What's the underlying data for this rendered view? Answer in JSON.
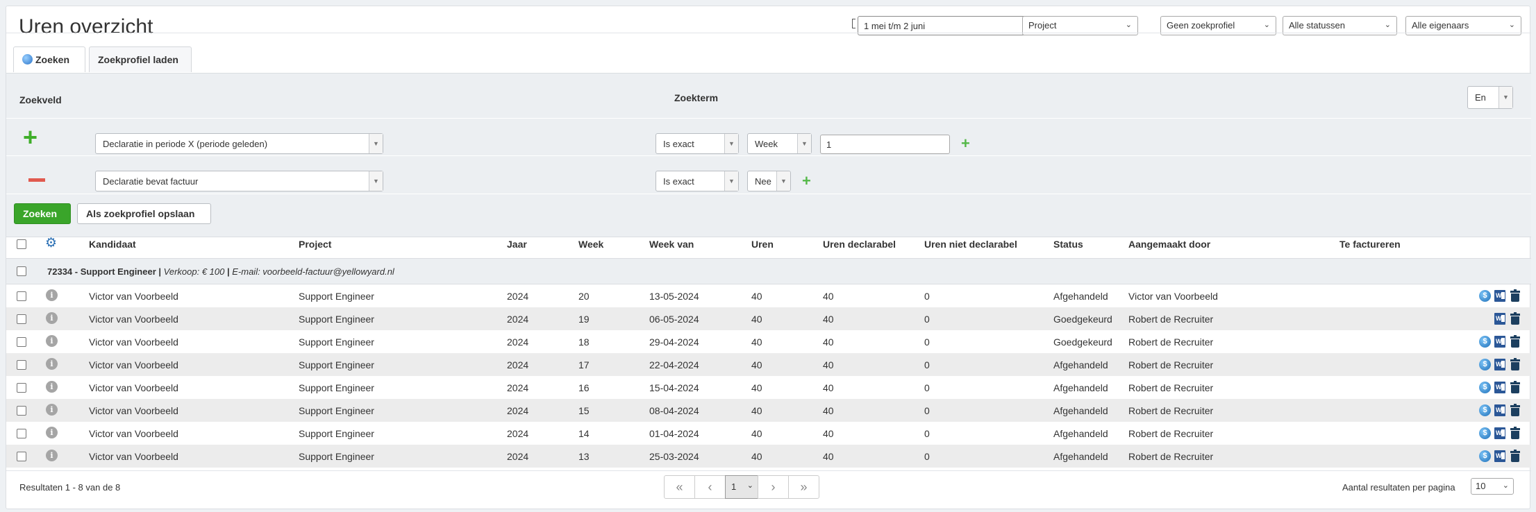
{
  "header": {
    "title": "Uren overzicht",
    "date_range": "1 mei t/m 2 juni",
    "filters": [
      "Project",
      "Geen zoekprofiel",
      "Alle statussen",
      "Alle eigenaars"
    ]
  },
  "tabs": {
    "search": "Zoeken",
    "load_profile": "Zoekprofiel laden"
  },
  "search": {
    "field_label": "Zoekveld",
    "term_label": "Zoekterm",
    "conjunction": "En",
    "conditions": [
      {
        "field": "Declaratie in periode X (periode geleden)",
        "operator": "Is exact",
        "unit": "Week",
        "value": "1"
      },
      {
        "field": "Declaratie bevat factuur",
        "operator": "Is exact",
        "unit": "Nee"
      }
    ],
    "search_button": "Zoeken",
    "save_button": "Als zoekprofiel opslaan"
  },
  "table": {
    "columns": [
      "Kandidaat",
      "Project",
      "Jaar",
      "Week",
      "Week van",
      "Uren",
      "Uren declarabel",
      "Uren niet declarabel",
      "Status",
      "Aangemaakt door",
      "Te factureren"
    ],
    "group": {
      "title": "72334 - Support Engineer",
      "sep1": "|",
      "sale": "Verkoop: € 100",
      "sep2": "|",
      "email": "E-mail: voorbeeld-factuur@yellowyard.nl"
    },
    "rows": [
      {
        "kandidaat": "Victor van Voorbeeld",
        "project": "Support Engineer",
        "jaar": "2024",
        "week": "20",
        "week_van": "13-05-2024",
        "uren": "40",
        "declarabel": "40",
        "niet_declarabel": "0",
        "status": "Afgehandeld",
        "door": "Victor van Voorbeeld",
        "invoice_icon": true
      },
      {
        "kandidaat": "Victor van Voorbeeld",
        "project": "Support Engineer",
        "jaar": "2024",
        "week": "19",
        "week_van": "06-05-2024",
        "uren": "40",
        "declarabel": "40",
        "niet_declarabel": "0",
        "status": "Goedgekeurd",
        "door": "Robert de Recruiter",
        "invoice_icon": false
      },
      {
        "kandidaat": "Victor van Voorbeeld",
        "project": "Support Engineer",
        "jaar": "2024",
        "week": "18",
        "week_van": "29-04-2024",
        "uren": "40",
        "declarabel": "40",
        "niet_declarabel": "0",
        "status": "Goedgekeurd",
        "door": "Robert de Recruiter",
        "invoice_icon": true
      },
      {
        "kandidaat": "Victor van Voorbeeld",
        "project": "Support Engineer",
        "jaar": "2024",
        "week": "17",
        "week_van": "22-04-2024",
        "uren": "40",
        "declarabel": "40",
        "niet_declarabel": "0",
        "status": "Afgehandeld",
        "door": "Robert de Recruiter",
        "invoice_icon": true
      },
      {
        "kandidaat": "Victor van Voorbeeld",
        "project": "Support Engineer",
        "jaar": "2024",
        "week": "16",
        "week_van": "15-04-2024",
        "uren": "40",
        "declarabel": "40",
        "niet_declarabel": "0",
        "status": "Afgehandeld",
        "door": "Robert de Recruiter",
        "invoice_icon": true
      },
      {
        "kandidaat": "Victor van Voorbeeld",
        "project": "Support Engineer",
        "jaar": "2024",
        "week": "15",
        "week_van": "08-04-2024",
        "uren": "40",
        "declarabel": "40",
        "niet_declarabel": "0",
        "status": "Afgehandeld",
        "door": "Robert de Recruiter",
        "invoice_icon": true
      },
      {
        "kandidaat": "Victor van Voorbeeld",
        "project": "Support Engineer",
        "jaar": "2024",
        "week": "14",
        "week_van": "01-04-2024",
        "uren": "40",
        "declarabel": "40",
        "niet_declarabel": "0",
        "status": "Afgehandeld",
        "door": "Robert de Recruiter",
        "invoice_icon": true
      },
      {
        "kandidaat": "Victor van Voorbeeld",
        "project": "Support Engineer",
        "jaar": "2024",
        "week": "13",
        "week_van": "25-03-2024",
        "uren": "40",
        "declarabel": "40",
        "niet_declarabel": "0",
        "status": "Afgehandeld",
        "door": "Robert de Recruiter",
        "invoice_icon": true
      }
    ]
  },
  "footer": {
    "results": "Resultaten 1 - 8 van de 8",
    "current_page": "1",
    "per_page_label": "Aantal resultaten per pagina",
    "per_page_value": "10"
  },
  "icons": {
    "add_condition": "plus-icon",
    "remove_condition": "minus-icon",
    "settings": "gear-icon",
    "info": "info-icon",
    "invoice": "invoice-icon",
    "word": "word-icon",
    "delete": "trash-icon"
  },
  "colors": {
    "primary_green": "#3aa52a",
    "remove_red": "#e05a4f",
    "row_alt": "#ececec"
  }
}
